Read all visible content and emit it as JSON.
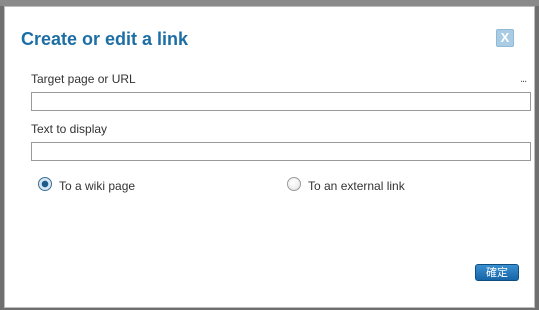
{
  "dialog": {
    "title": "Create or edit a link",
    "close_label": "X",
    "target_field": {
      "label": "Target page or URL",
      "value": "",
      "more_label": "..."
    },
    "display_field": {
      "label": "Text to display",
      "value": ""
    },
    "link_type": {
      "options": [
        {
          "label": "To a wiki page",
          "selected": true
        },
        {
          "label": "To an external link",
          "selected": false
        }
      ]
    },
    "confirm_label": "確定"
  },
  "colors": {
    "title": "#1c6ea4",
    "close_button": "#a9cce4",
    "confirm_button": "#1565a8",
    "overlay": "#6f6f6f"
  },
  "icons": {
    "close": "close-icon",
    "radio_checked": "radio-checked-icon",
    "radio_unchecked": "radio-unchecked-icon"
  }
}
